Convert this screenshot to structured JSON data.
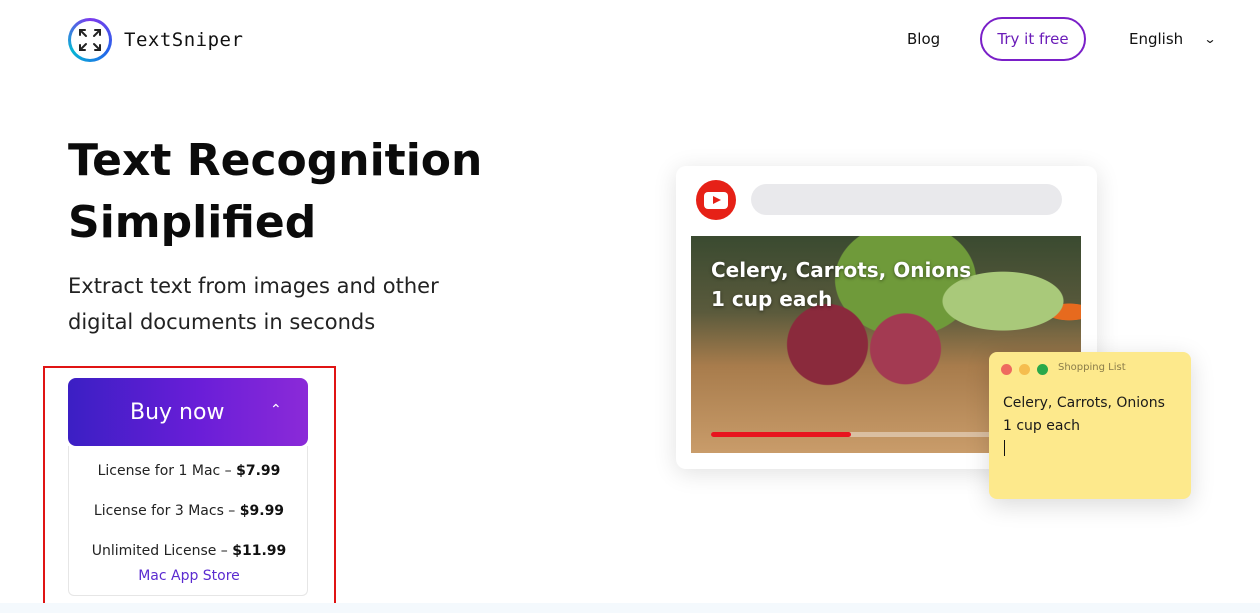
{
  "header": {
    "brand": "TextSniper",
    "nav_blog": "Blog",
    "try_free": "Try it free",
    "language": "English",
    "lang_chevron": "⌄"
  },
  "hero": {
    "title_line1": "Text Recognition",
    "title_line2": "Simplified",
    "subtitle_line1": "Extract text from images and other",
    "subtitle_line2": "digital documents in seconds"
  },
  "buy": {
    "label": "Buy now",
    "chevron": "⌃",
    "options": [
      {
        "text": "License for 1 Mac – ",
        "price": "$7.99"
      },
      {
        "text": "License for 3 Macs – ",
        "price": "$9.99"
      },
      {
        "text": "Unlimited License – ",
        "price": "$11.99"
      }
    ],
    "store": "Mac App Store"
  },
  "illustration": {
    "video_caption_line1": "Celery, Carrots, Onions",
    "video_caption_line2": "1 cup each",
    "video_progress": 0.39,
    "note_title": "Shopping List",
    "note_line1": "Celery, Carrots, Onions",
    "note_line2": "1 cup each"
  },
  "colors": {
    "accent_purple": "#6a1bb8",
    "buy_gradient_start": "#3b1fc4",
    "buy_gradient_end": "#8b2ad8",
    "highlight_red": "#e01414",
    "youtube_red": "#e62117",
    "note_yellow": "#fde98c"
  },
  "icons": {
    "logo": "scan-corners-icon",
    "youtube": "youtube-icon"
  }
}
